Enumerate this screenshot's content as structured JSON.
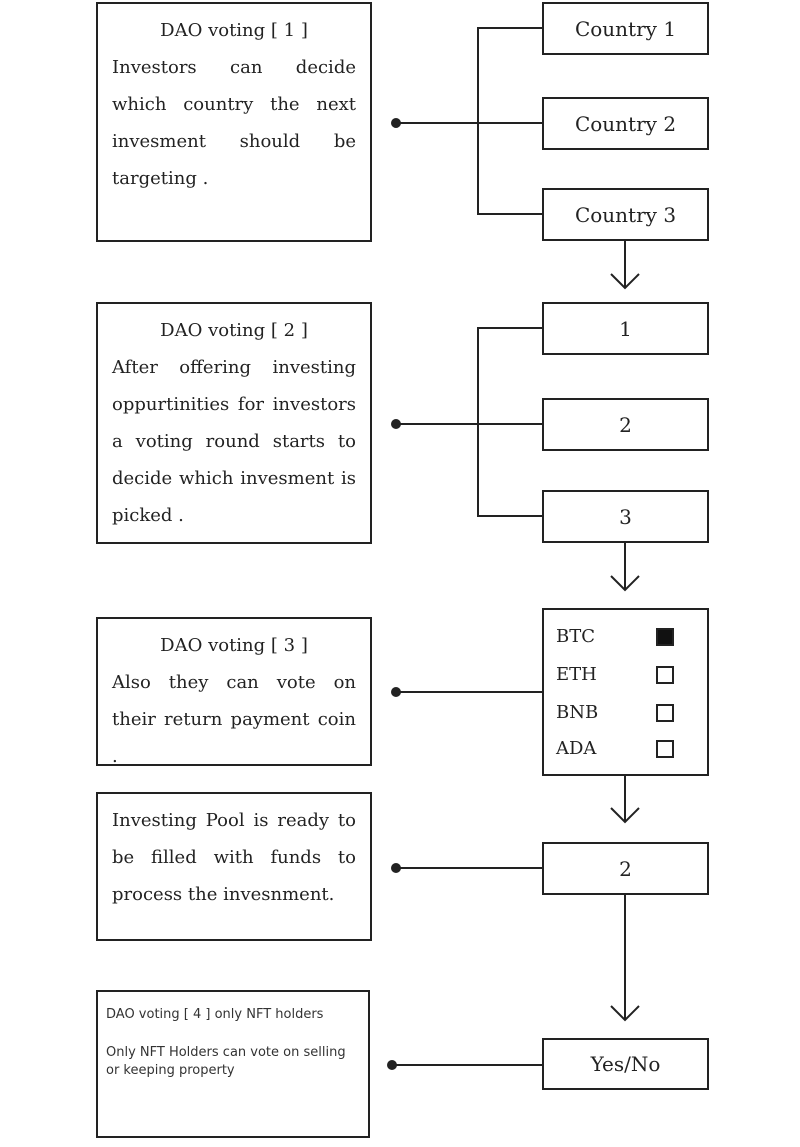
{
  "steps": [
    {
      "title": "DAO voting [ 1 ]",
      "body": "Investors can decide which country the next invesment should be targeting ."
    },
    {
      "title": "DAO voting [ 2 ]",
      "body": "After offering investing oppurtinities for investors a voting round starts to decide which invesment is picked ."
    },
    {
      "title": "DAO voting [ 3 ]",
      "body": "Also they can vote on their return payment coin ."
    },
    {
      "title": "",
      "body": "Investing Pool is ready to be filled with funds to process the invesnment."
    },
    {
      "title": "DAO voting [ 4 ] only NFT holders",
      "body": "Only NFT Holders can vote on selling or keeping property"
    }
  ],
  "countries": [
    "Country 1",
    "Country 2",
    "Country 3"
  ],
  "investments": [
    "1",
    "2",
    "3"
  ],
  "coins": [
    {
      "label": "BTC",
      "checked": true
    },
    {
      "label": "ETH",
      "checked": false
    },
    {
      "label": "BNB",
      "checked": false
    },
    {
      "label": "ADA",
      "checked": false
    }
  ],
  "pool_box": "2",
  "final_vote": "Yes/No"
}
